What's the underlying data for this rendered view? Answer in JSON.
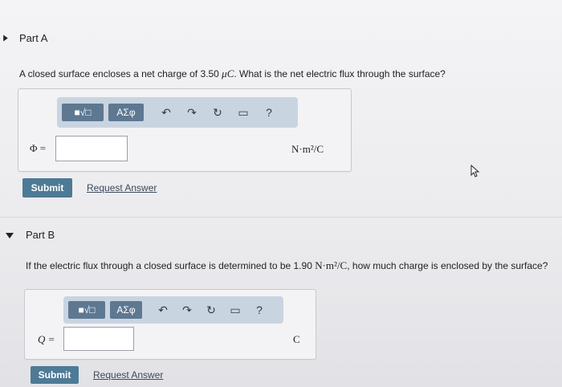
{
  "partA": {
    "title": "Part A",
    "question_prefix": "A closed surface encloses a net charge of 3.50",
    "question_unit": "μC",
    "question_suffix": ". What is the net electric flux through the surface?",
    "var_label": "Φ =",
    "units": "N·m²/C",
    "submit_label": "Submit",
    "request_label": "Request Answer"
  },
  "partB": {
    "title": "Part B",
    "question_prefix": "If the electric flux through a closed surface is determined to be 1.90",
    "question_unit": "N·m²/C",
    "question_suffix": ", how much charge is enclosed by the surface?",
    "var_label": "Q =",
    "units": "C",
    "submit_label": "Submit",
    "request_label": "Request Answer"
  },
  "toolbar": {
    "template_glyph": "■√□",
    "symbols_label": "ΑΣφ",
    "undo_glyph": "↶",
    "redo_glyph": "↷",
    "reset_glyph": "↻",
    "keyboard_glyph": "▭",
    "help_glyph": "?"
  },
  "colors": {
    "accent": "#4d7a96",
    "toolbar_bg": "#c9d4e1",
    "toolbar_btn": "#5e7892"
  }
}
